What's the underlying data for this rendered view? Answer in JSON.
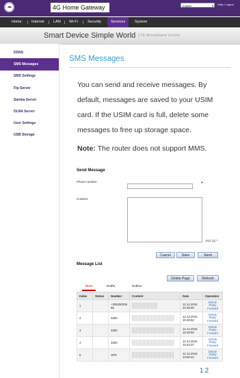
{
  "header": {
    "brand": "4G Home Gateway",
    "language": "English",
    "help_label": "Help / Logout"
  },
  "nav": {
    "items": [
      "Home",
      "Internet",
      "LAN",
      "Wi-Fi",
      "Security",
      "Services",
      "System"
    ],
    "active": "Services"
  },
  "tagline": {
    "main": "Smart Device  Simple World",
    "sub": "LTE Broadband Center"
  },
  "sidebar": {
    "items": [
      "DDNS",
      "SMS Messages",
      "SMS Settings",
      "Ftp Server",
      "Samba Server",
      "DLNA Server",
      "User Settings",
      "USB Storage"
    ],
    "active": "SMS Messages"
  },
  "page": {
    "title": "SMS Messages",
    "intro": "You can send and receive messages. By default, messages are saved to your USIM card. If the USIM card is full, delete some messages to free up storage space.",
    "note_label": "Note:",
    "note_text": " The router does not support MMS."
  },
  "send": {
    "title": "Send Message",
    "phone_label": "Phone number:",
    "content_label": "Content:",
    "required_mark": "*",
    "counter": "612 (1)",
    "cancel": "Cancel",
    "save": "Save",
    "send": "Send"
  },
  "list": {
    "title": "Message List",
    "delete_page": "Delete Page",
    "refresh": "Refresh",
    "tabs": [
      "Inbox",
      "Drafts",
      "Outbox"
    ],
    "active_tab": "Inbox",
    "columns": [
      "Index",
      "Status",
      "Number",
      "Content",
      "Date",
      "Operation"
    ],
    "ops": [
      "Delete",
      "Reply",
      "Forward"
    ],
    "rows": [
      {
        "index": "1",
        "status": "",
        "number": "+336250336 59",
        "date": "12.14.2015 22:45:00"
      },
      {
        "index": "2",
        "status": "",
        "number": "3300",
        "date": "12.14.2015 15:48:50"
      },
      {
        "index": "3",
        "status": "",
        "number": "3300",
        "date": "12.14.2015 15:48:50"
      },
      {
        "index": "4",
        "status": "",
        "number": "3300",
        "date": "12.14.2015 15:43:37"
      },
      {
        "index": "5",
        "status": "",
        "number": "SFR",
        "date": "12.12.2015 10:50:44"
      }
    ]
  },
  "pager": {
    "pages": [
      "1",
      "2"
    ]
  },
  "colors": {
    "brand_purple": "#4b2a74",
    "active_purple": "#5d2f8e",
    "title_blue": "#3a9fd6",
    "link_blue": "#2a6dc0"
  }
}
